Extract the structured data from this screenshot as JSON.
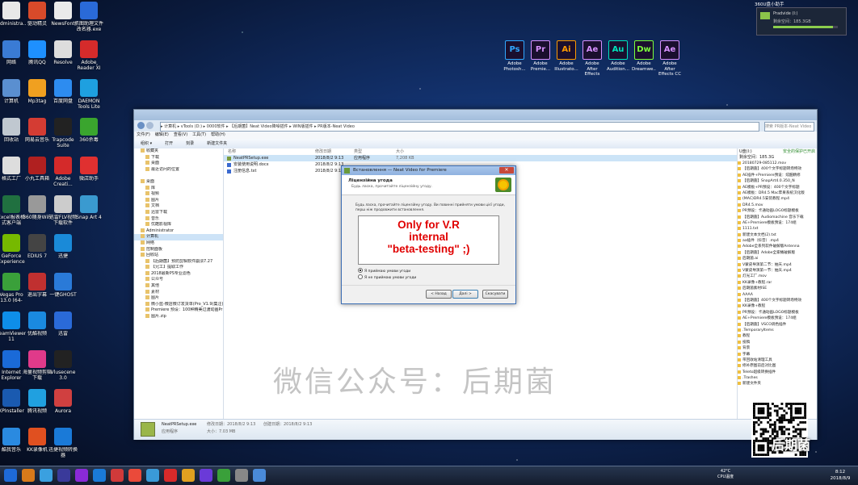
{
  "desktop_icons": [
    {
      "label": "Administra...",
      "color": "#e8e8e8"
    },
    {
      "label": "驱动精灵",
      "color": "#d84a2a"
    },
    {
      "label": "NewsFont",
      "color": "#eaeaea"
    },
    {
      "label": "抓图助理文件改名器.exe",
      "color": "#2a6ad8"
    },
    {
      "label": "网络",
      "color": "#3a7bd5"
    },
    {
      "label": "腾讯QQ",
      "color": "#1e90ff"
    },
    {
      "label": "Resolve",
      "color": "#ddd"
    },
    {
      "label": "Adobe Reader XI",
      "color": "#d52b2b"
    },
    {
      "label": "计算机",
      "color": "#5a8fd0"
    },
    {
      "label": "Mp3tag",
      "color": "#f0a020"
    },
    {
      "label": "百度网盘",
      "color": "#2d8cf0"
    },
    {
      "label": "DAEMON Tools Lite",
      "color": "#1ea0e0"
    },
    {
      "label": "回收站",
      "color": "#c0c8d0"
    },
    {
      "label": "网易云音乐",
      "color": "#d43c33"
    },
    {
      "label": "Trapcode Suite 12.1...",
      "color": "#222"
    },
    {
      "label": "360杀毒",
      "color": "#3aa52e"
    },
    {
      "label": "格式工厂",
      "color": "#ddd"
    },
    {
      "label": "小丸工具箱",
      "color": "#b02020"
    },
    {
      "label": "Adobe Creati...",
      "color": "#d42a2a"
    },
    {
      "label": "微店助手",
      "color": "#e03030"
    },
    {
      "label": "Excel报表格式客户端",
      "color": "#207040"
    },
    {
      "label": "360随身WiFi",
      "color": "#999"
    },
    {
      "label": "迅雷FLV视频下载软件",
      "color": "#ccc"
    },
    {
      "label": "Snap Art 4",
      "color": "#3a9ad0"
    },
    {
      "label": "GeForce Experience",
      "color": "#76b900"
    },
    {
      "label": "EDIUS 7",
      "color": "#444"
    },
    {
      "label": "迅捷",
      "color": "#1a8ad8"
    },
    {
      "label": "Vegas Pro 13.0 (64-bit)",
      "color": "#3aa03a"
    },
    {
      "label": "退出字幕",
      "color": "#c03030"
    },
    {
      "label": "一键GHOST",
      "color": "#2a7ad8"
    },
    {
      "label": "TeamViewer 11",
      "color": "#0e8ee9"
    },
    {
      "label": "优酷视频",
      "color": "#1a8ae0"
    },
    {
      "label": "迅雷",
      "color": "#2a6ad8"
    },
    {
      "label": "Internet Explorer",
      "color": "#1a6ad8"
    },
    {
      "label": "海量视频剪辑下载",
      "color": "#e03a8a"
    },
    {
      "label": "Vlusecene 3.0",
      "color": "#222"
    },
    {
      "label": "XPInstaller",
      "color": "#1a5ab0"
    },
    {
      "label": "腾讯视频",
      "color": "#20a0e0"
    },
    {
      "label": "Aurora",
      "color": "#d04040"
    },
    {
      "label": "酷我音乐",
      "color": "#2a8ae0"
    },
    {
      "label": "KK录像机",
      "color": "#e05020"
    },
    {
      "label": "迅捷视频转换器",
      "color": "#1a7ad8"
    }
  ],
  "adobe_icons": [
    {
      "abbr": "Ps",
      "label": "Adobe Photosh...",
      "color": "#31a8ff"
    },
    {
      "abbr": "Pr",
      "label": "Adobe Premie...",
      "color": "#d791ff"
    },
    {
      "abbr": "Ai",
      "label": "Adobe Illustrato...",
      "color": "#ff9a00"
    },
    {
      "abbr": "Ae",
      "label": "Adobe After Effects CC...",
      "color": "#d791ff"
    },
    {
      "abbr": "Au",
      "label": "Adobe Audition...",
      "color": "#00e4bb"
    },
    {
      "abbr": "Dw",
      "label": "Adobe Dreamwe...",
      "color": "#7cff3c"
    },
    {
      "abbr": "Ae",
      "label": "Adobe After Effects CC 2017",
      "color": "#d791ff"
    }
  ],
  "widget": {
    "title": "360U盘小助手",
    "drive": "Pradvide (I:)",
    "space": "剩余空间：185.3GB"
  },
  "explorer": {
    "address": "▸ 计算机 ▸ vTools (D:) ▸ 0000软件 ▸ 【后期菌】Neat Video降噪插件 ▸ WIN版插件 ▸ PR版本-Neat Video",
    "search": "搜索 PR版本-Neat Video",
    "menu": [
      "文件(F)",
      "编辑(E)",
      "查看(V)",
      "工具(T)",
      "帮助(H)"
    ],
    "toolbar": [
      "组织 ▾",
      "打开",
      "刻录",
      "新建文件夹"
    ],
    "nav": [
      "收藏夹",
      "下载",
      "桌面",
      "最近访问的位置",
      "",
      "桌面",
      "库",
      "视频",
      "图片",
      "文档",
      "迅雷下载",
      "音乐",
      "优酷影视库",
      "Administrator",
      "计算机",
      "网络",
      "控制面板",
      "回收站",
      "【后期菌】预防剪辑软件崩溃7.27",
      "【兄工】提取工作",
      "2018最新PS专业滤色",
      "公众号",
      "其他",
      "素材",
      "图片",
      "微小蓝-微店微订发货单(Pro_V1.9(集汪)",
      "Premiere 预设：100种精美过渡动画Pr",
      "图片.zip"
    ],
    "columns": {
      "name": "名称",
      "date": "修改日期",
      "type": "类型",
      "size": "大小"
    },
    "files": [
      {
        "name": "NeatPRSetup.exe",
        "date": "2018/8/2 9:13",
        "type": "应用程序",
        "size": "7,208 KB"
      },
      {
        "name": "安装使用说明.docx",
        "date": "2018/8/2 9:13",
        "type": "",
        "size": ""
      },
      {
        "name": "注册信息.txt",
        "date": "2018/8/2 9:13",
        "type": "",
        "size": ""
      }
    ],
    "right_header": "U盘(I:)",
    "right_link": "安全的保护已开启",
    "right_space": "剩余空间：185.3G",
    "right_items": [
      "20180729-085112.mov",
      "【后期菌】400个文字标题转场特效",
      "AE插件+Premiere预设：炫酷精修",
      "【后期菌】SnapArt4.0.350_N",
      "AE模板+PR预设：400个文字标题",
      "AE模板：DR4.5 Mac苹果系统汉化版",
      "(MAC)DR4.5安装教程.mp4",
      "DR4.5.mov",
      "PR预设：卡通动画LOGO标题模板",
      "【后期菌】Audiomachine 音乐下载",
      "AE+Premiere模板预设：174组",
      "1111.txt",
      "新建文本文档(2).txt",
      "aa插件（抖音）.mp4",
      "Adobe全系列软件破解版Antenna",
      "【后期菌】Adobe全家桶破解版",
      "后期菌.ai",
      "V蒙皮导演第二节：抽天.mp4",
      "V蒙皮导演第一节：抽天.mp4",
      "灯光工厂.mov",
      "KK录像+教程.rar",
      "后期菌素材ISE",
      "AAAA",
      "【后期菌】400个文字标题转场特效",
      "KK录像+教程",
      "PR预设：卡通动画LOGO标题模板",
      "AE+Premiere模板预设：174组",
      "【后期菌】VSCO调色插件",
      ".TemporaryItems",
      "教程",
      "投稿",
      "背景",
      "字幕",
      "带回收站清理工具",
      "修补原图前后对比图",
      "Teleto超级转换插件",
      ".Trashes",
      "新建文件夹"
    ],
    "details": {
      "name": "NeatPRSetup.exe",
      "modified": "修改日期：2018/8/2 9:13",
      "created": "创建日期：2018/8/2 9:13",
      "type": "应用程序",
      "size": "大小：7.03 MB"
    }
  },
  "dialog": {
    "title": "Встановлення — Neat Video for Premiere",
    "close": "✕",
    "heading": "Ліцензійна угода",
    "subheading": "Будь ласка, прочитайте ліцензійну угоду.",
    "intro": "Будь ласка, прочитайте ліцензійну угоду. Ви повинні прийняти умови цієї угоди, перш ніж продовжити встановлення.",
    "license_lines": [
      "Only for V.R",
      "internal",
      "\"beta-testing\" ;)"
    ],
    "radio_accept": "Я приймаю умови угоди",
    "radio_decline": "Я не приймаю умови угоди",
    "btn_back": "< Назад",
    "btn_next": "Далі >",
    "btn_cancel": "Скасувати"
  },
  "watermark": "微信公众号：后期菌",
  "qr_brand": "后期菌",
  "tray": {
    "temp": "42°C",
    "cpu": "CPU温度",
    "time": "8:12",
    "date": "2018/8/9"
  }
}
